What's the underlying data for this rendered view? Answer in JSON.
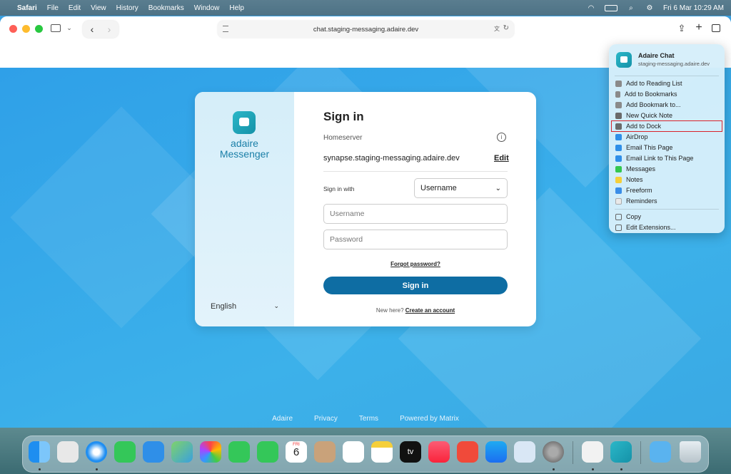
{
  "menubar": {
    "app": "Safari",
    "items": [
      "File",
      "Edit",
      "View",
      "History",
      "Bookmarks",
      "Window",
      "Help"
    ],
    "datetime": "Fri 6 Mar  10:29 AM"
  },
  "browser": {
    "address": "chat.staging-messaging.adaire.dev"
  },
  "login": {
    "brand_line1": "adaire",
    "brand_line2": "Messenger",
    "language": "English",
    "title": "Sign in",
    "homeserver_label": "Homeserver",
    "homeserver_value": "synapse.staging-messaging.adaire.dev",
    "edit_label": "Edit",
    "sign_in_with_label": "Sign in with",
    "sign_in_with_value": "Username",
    "username_placeholder": "Username",
    "password_placeholder": "Password",
    "forgot_label": "Forgot password?",
    "submit_label": "Sign in",
    "new_here": "New here?",
    "create_account": "Create an account"
  },
  "footer": {
    "links": [
      "Adaire",
      "Privacy",
      "Terms",
      "Powered by Matrix"
    ]
  },
  "share_menu": {
    "title": "Adaire Chat",
    "subtitle": "staging-messaging.adaire.dev",
    "items": [
      {
        "label": "Add to Reading List",
        "color": "#8a8a8a"
      },
      {
        "label": "Add to Bookmarks",
        "color": "#8a8a8a"
      },
      {
        "label": "Add Bookmark to...",
        "color": "#8a8a8a"
      },
      {
        "label": "New Quick Note",
        "color": "#6a6a6a"
      },
      {
        "label": "Add to Dock",
        "color": "#6a6a6a"
      },
      {
        "label": "AirDrop",
        "color": "#2f8fe8"
      },
      {
        "label": "Email This Page",
        "color": "#2f8fe8"
      },
      {
        "label": "Email Link to This Page",
        "color": "#2f8fe8"
      },
      {
        "label": "Messages",
        "color": "#33c74f"
      },
      {
        "label": "Notes",
        "color": "#f5cf3a"
      },
      {
        "label": "Freeform",
        "color": "#3a8ee8"
      },
      {
        "label": "Reminders",
        "color": "#e9e9e9"
      }
    ],
    "copy_label": "Copy",
    "edit_ext_label": "Edit Extensions..."
  },
  "dock": {
    "calendar_month": "FRI",
    "calendar_day": "6",
    "tv_label": "tv"
  }
}
